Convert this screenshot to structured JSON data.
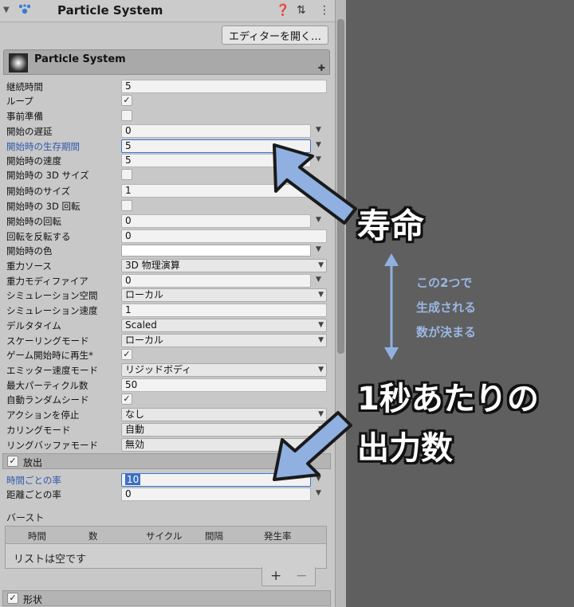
{
  "header": {
    "title": "Particle System",
    "help_icon": "help-icon",
    "settings_icon": "settings-sliders-icon",
    "menu_icon": "kebab-menu-icon"
  },
  "editor_button": "エディターを開く…",
  "module": {
    "title": "Particle System"
  },
  "rows": {
    "duration": {
      "label": "継続時間",
      "value": "5"
    },
    "looping": {
      "label": "ループ",
      "checked": "✓"
    },
    "prewarm": {
      "label": "事前準備"
    },
    "start_delay": {
      "label": "開始の遅延",
      "value": "0"
    },
    "start_lifetime": {
      "label": "開始時の生存期間",
      "value": "5"
    },
    "start_speed": {
      "label": "開始時の速度",
      "value": "5"
    },
    "size_3d": {
      "label": "開始時の 3D サイズ"
    },
    "start_size": {
      "label": "開始時のサイズ",
      "value": "1"
    },
    "rotation_3d": {
      "label": "開始時の 3D 回転"
    },
    "start_rotation": {
      "label": "開始時の回転",
      "value": "0"
    },
    "flip_rotation": {
      "label": "回転を反転する",
      "value": "0"
    },
    "start_color": {
      "label": "開始時の色",
      "color": "#ffffff"
    },
    "gravity_source": {
      "label": "重力ソース",
      "value": "3D 物理演算"
    },
    "gravity_modifier": {
      "label": "重力モディファイア",
      "value": "0"
    },
    "simulation_space": {
      "label": "シミュレーション空間",
      "value": "ローカル"
    },
    "simulation_speed": {
      "label": "シミュレーション速度",
      "value": "1"
    },
    "delta_time": {
      "label": "デルタタイム",
      "value": "Scaled"
    },
    "scaling_mode": {
      "label": "スケーリングモード",
      "value": "ローカル"
    },
    "play_on_awake": {
      "label": "ゲーム開始時に再生*",
      "checked": "✓"
    },
    "emitter_velocity": {
      "label": "エミッター速度モード",
      "value": "リジッドボディ"
    },
    "max_particles": {
      "label": "最大パーティクル数",
      "value": "50"
    },
    "auto_random_seed": {
      "label": "自動ランダムシード",
      "checked": "✓"
    },
    "stop_action": {
      "label": "アクションを停止",
      "value": "なし"
    },
    "culling_mode": {
      "label": "カリングモード",
      "value": "自動"
    },
    "ring_buffer": {
      "label": "リングバッファモード",
      "value": "無効"
    }
  },
  "emission": {
    "title": "放出",
    "checked": "✓",
    "rate_over_time": {
      "label": "時間ごとの率",
      "value": "10"
    },
    "rate_over_distance": {
      "label": "距離ごとの率",
      "value": "0"
    },
    "burst_label": "バースト",
    "burst_columns": [
      "時間",
      "数",
      "サイクル",
      "間隔",
      "発生率"
    ],
    "burst_empty": "リストは空です",
    "add": "+",
    "remove": "−"
  },
  "shape": {
    "title": "形状",
    "checked": "✓"
  },
  "annotations": {
    "lifetime": "寿命",
    "note_lines": [
      "この2つで",
      "生成される",
      "数が決まる"
    ],
    "rate_line1": "1秒あたりの",
    "rate_line2": "出力数",
    "arrow_color": "#8fb0e0"
  }
}
